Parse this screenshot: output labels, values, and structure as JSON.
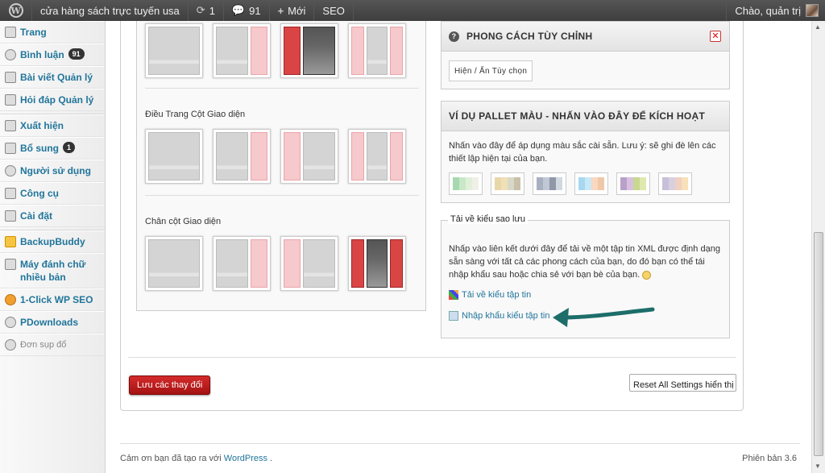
{
  "adminbar": {
    "site_name": "cửa hàng sách trực tuyến usa",
    "updates_count": "1",
    "comments_count": "91",
    "new_label": "Mới",
    "seo_label": "SEO",
    "greeting": "Chào, quản trị"
  },
  "sidebar": {
    "items": [
      {
        "label": "Trang",
        "icon": "page-icon"
      },
      {
        "label": "Bình luận",
        "badge": "91",
        "icon": "comment-icon"
      },
      {
        "label": "Bài viết Quản lý",
        "icon": "posts-icon"
      },
      {
        "label": "Hỏi đáp Quản lý",
        "icon": "faq-icon"
      },
      {
        "label": "Xuất hiện",
        "icon": "appearance-icon"
      },
      {
        "label": "Bổ sung",
        "badge": "1",
        "icon": "plugin-icon"
      },
      {
        "label": "Người sử dụng",
        "icon": "users-icon"
      },
      {
        "label": "Công cụ",
        "icon": "tools-icon"
      },
      {
        "label": "Cài đặt",
        "icon": "settings-icon"
      },
      {
        "label": "BackupBuddy",
        "icon": "backup-icon"
      },
      {
        "label": "Máy đánh chữ nhiều bản",
        "icon": "typewriter-icon"
      },
      {
        "label": "1-Click WP SEO",
        "icon": "seo-icon"
      },
      {
        "label": "PDownloads",
        "icon": "gear-icon"
      },
      {
        "label": "Đơn sụp đổ",
        "icon": "collapse-icon"
      }
    ]
  },
  "left": {
    "section_column_nav": "Điều Trang Cột Giao diện",
    "section_footer_columns": "Chân cột Giao diện"
  },
  "custom_style": {
    "title": "PHONG CÁCH TÙY CHỈNH",
    "toggle_label": "Hiện / Ẩn Tùy chọn"
  },
  "palette": {
    "title": "VÍ DỤ PALLET MÀU - NHẤN VÀO ĐÂY ĐỂ KÍCH HOẠT",
    "description": "Nhấn vào đây để áp dụng màu sắc cài sẵn. Lưu ý: sẽ ghi đè lên các thiết lập hiện tại của bạn.",
    "swatches": [
      [
        "#a8d8b0",
        "#c8e8c8",
        "#e0f0d8",
        "#f0f0e8"
      ],
      [
        "#e8d8a8",
        "#f0e0b8",
        "#d8d8c8",
        "#c8c0a8"
      ],
      [
        "#a8b0c0",
        "#c0c8d8",
        "#9098a8",
        "#d0d8e0"
      ],
      [
        "#a8d8f0",
        "#c8e8f8",
        "#f8d8c0",
        "#f0c8a8"
      ],
      [
        "#b8a0c8",
        "#d8c0e0",
        "#c8d890",
        "#e0e8b0"
      ],
      [
        "#c8c0d8",
        "#d8d0e0",
        "#f0d0c0",
        "#f8e0b8"
      ]
    ]
  },
  "backup": {
    "legend": "Tải về kiểu sao lưu",
    "description": "Nhấp vào liên kết dưới đây để tải về một tập tin XML được định dạng sẵn sàng với tất cả các phong cách của bạn, do đó bạn có thể tái nhập khẩu sau hoặc chia sẻ với bạn bè của bạn.",
    "download_link": "Tải về kiểu tập tin",
    "import_link": "Nhập khẩu kiểu tập tin"
  },
  "buttons": {
    "save": "Lưu các thay đổi",
    "reset": "Reset All Settings hiển thị"
  },
  "footer": {
    "thanks_prefix": "Cảm ơn bạn đã tạo ra với",
    "wordpress": "WordPress",
    "thanks_suffix": ".",
    "version": "Phiên bản 3.6"
  },
  "colors": {
    "accent": "#21759b",
    "save_button": "#c41e1e",
    "arrow": "#1d6e6a"
  }
}
